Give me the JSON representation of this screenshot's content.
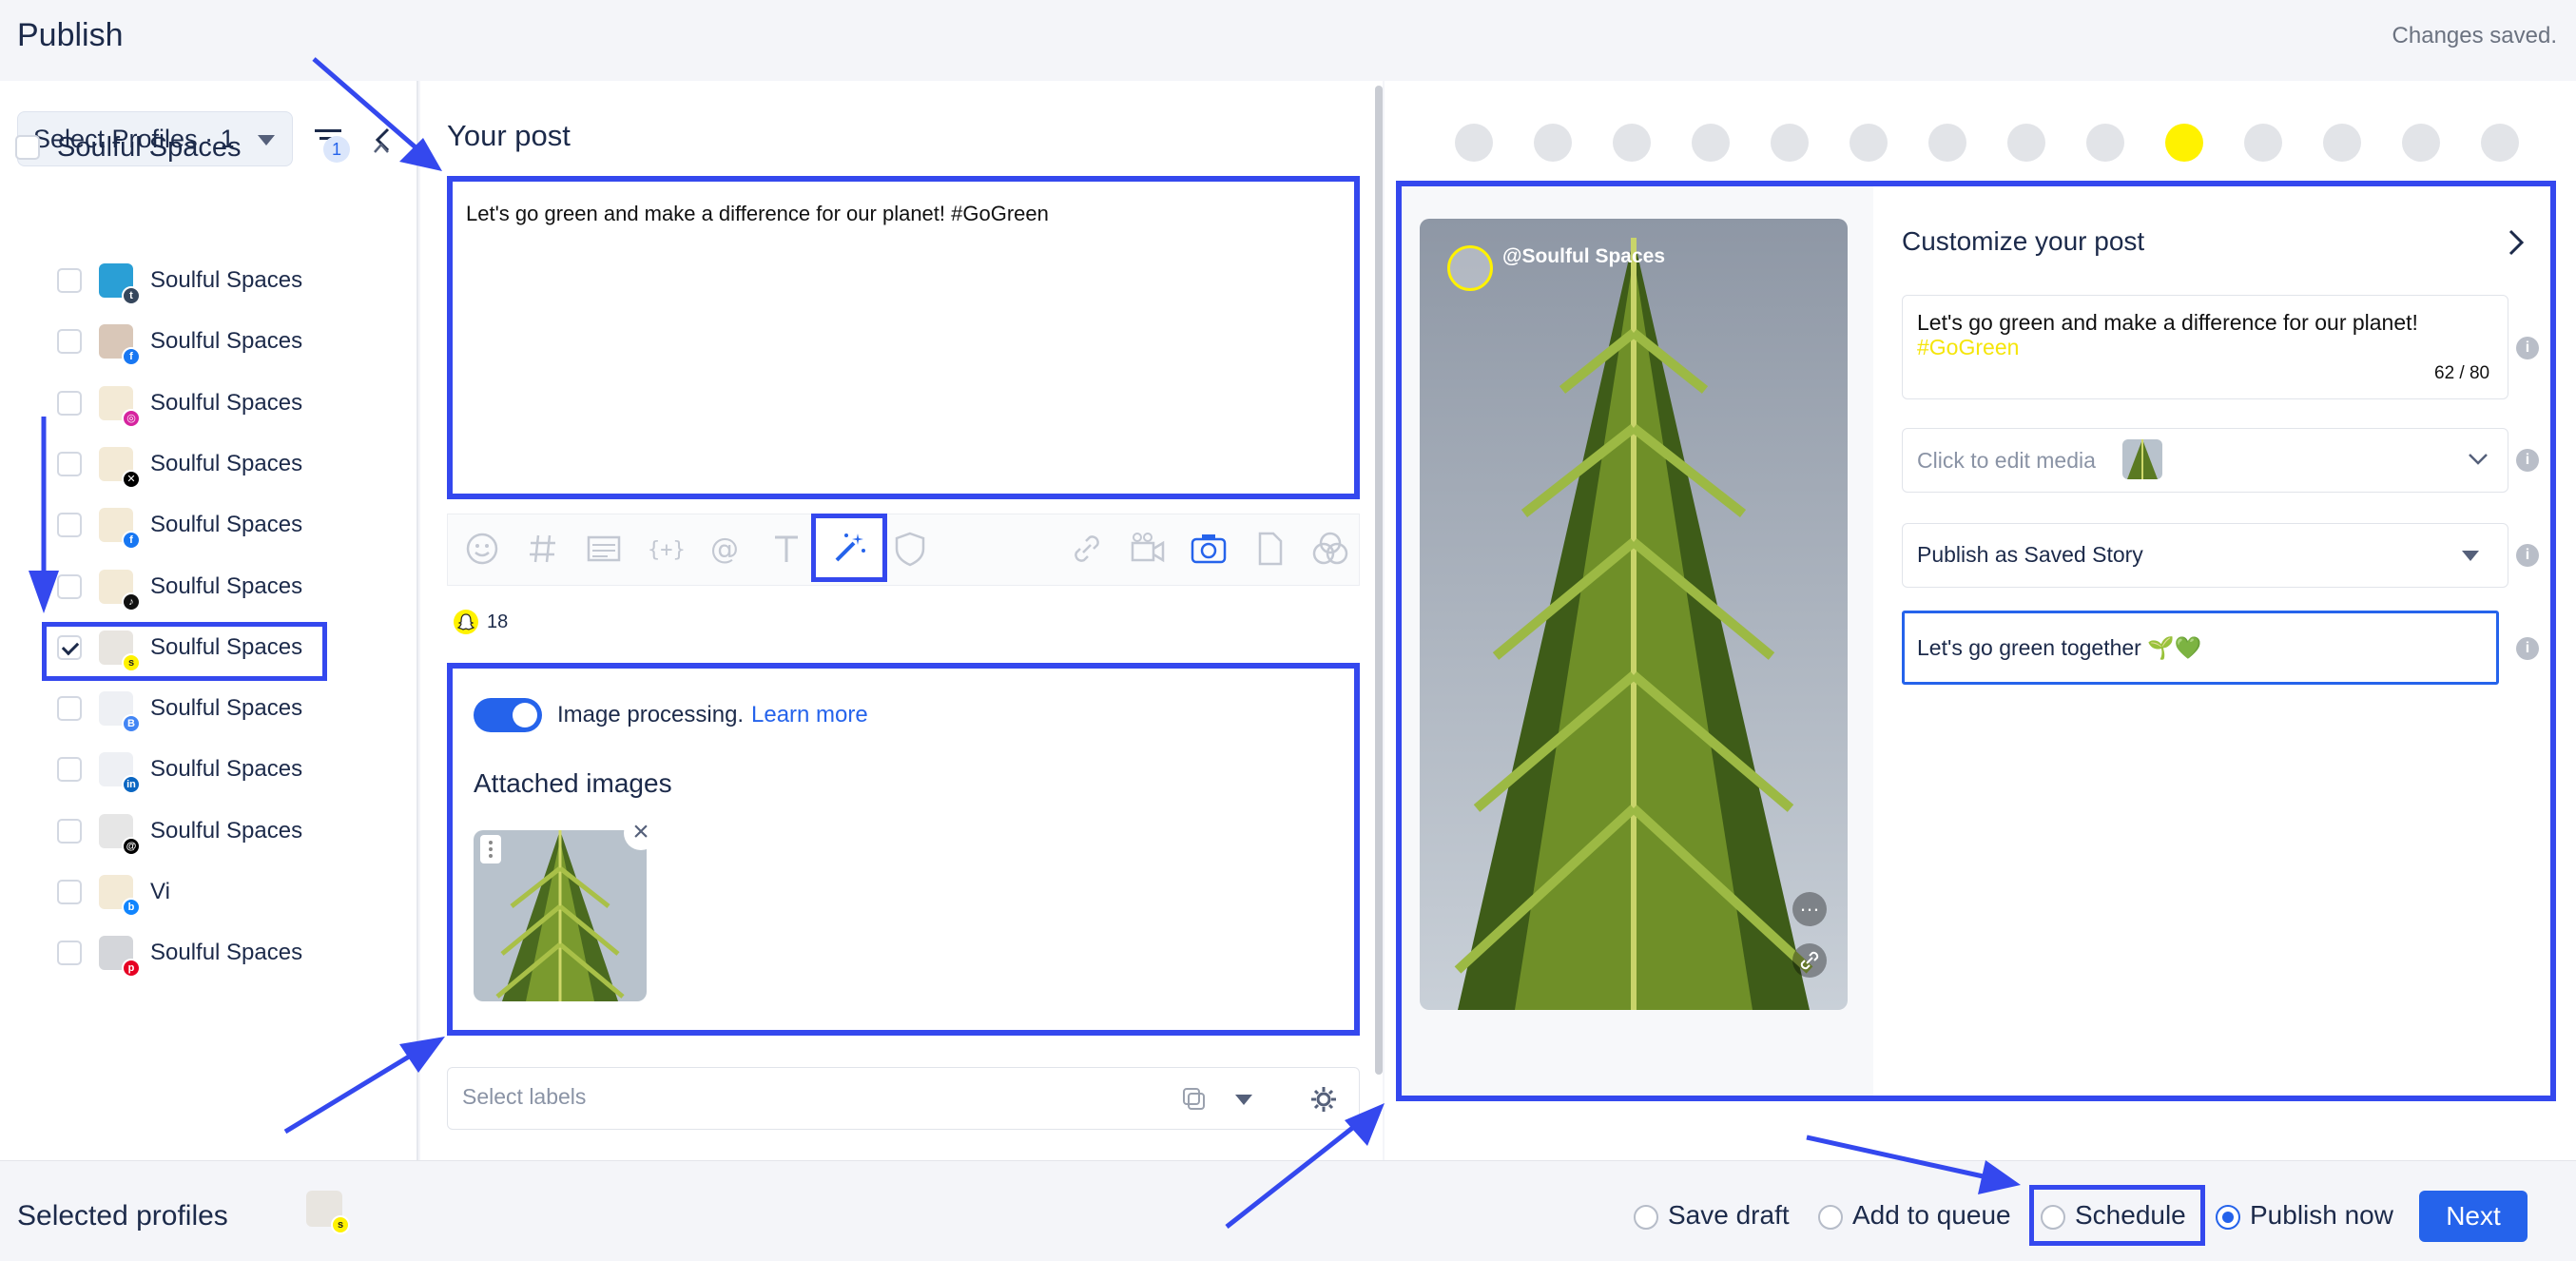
{
  "header": {
    "title": "Publish",
    "status": "Changes saved."
  },
  "sidebar": {
    "profile_select": "Select Profiles · 1",
    "group": {
      "name": "Soulful Spaces",
      "count": "1"
    },
    "profiles": [
      {
        "label": "Soulful Spaces",
        "network": "tumblr",
        "checked": false
      },
      {
        "label": "Soulful Spaces",
        "network": "facebook",
        "checked": false
      },
      {
        "label": "Soulful Spaces",
        "network": "instagram",
        "checked": false
      },
      {
        "label": "Soulful Spaces",
        "network": "x",
        "checked": false
      },
      {
        "label": "Soulful Spaces",
        "network": "facebook",
        "checked": false
      },
      {
        "label": "Soulful Spaces",
        "network": "tiktok",
        "checked": false
      },
      {
        "label": "Soulful Spaces",
        "network": "snapchat",
        "checked": true
      },
      {
        "label": "Soulful Spaces",
        "network": "google-business",
        "checked": false
      },
      {
        "label": "Soulful Spaces",
        "network": "linkedin",
        "checked": false
      },
      {
        "label": "Soulful Spaces",
        "network": "threads",
        "checked": false
      },
      {
        "label": "Vi",
        "network": "bluesky",
        "checked": false
      },
      {
        "label": "Soulful Spaces",
        "network": "pinterest",
        "checked": false
      }
    ]
  },
  "composer": {
    "heading": "Your post",
    "text": "Let's go green and make a difference for our planet! #GoGreen",
    "snap_count": "18",
    "image_processing": "Image processing.",
    "learn_more": "Learn more",
    "attached_heading": "Attached images",
    "labels_placeholder": "Select labels"
  },
  "preview": {
    "handle": "@Soulful Spaces",
    "customize_title": "Customize your post",
    "caption": "Let's go green and make a difference for our planet!",
    "hashtag": "#GoGreen",
    "char_count": "62 / 80",
    "media_placeholder": "Click to edit media",
    "publish_as": "Publish as Saved Story",
    "story_text": "Let's go green together 🌱💚"
  },
  "footer": {
    "selected_profiles": "Selected profiles",
    "options": [
      "Save draft",
      "Add to queue",
      "Schedule",
      "Publish now"
    ],
    "selected_option": "Publish now",
    "next": "Next"
  },
  "colors": {
    "accent": "#2563eb",
    "highlight": "#3448ee",
    "snap_yellow": "#fff200"
  }
}
